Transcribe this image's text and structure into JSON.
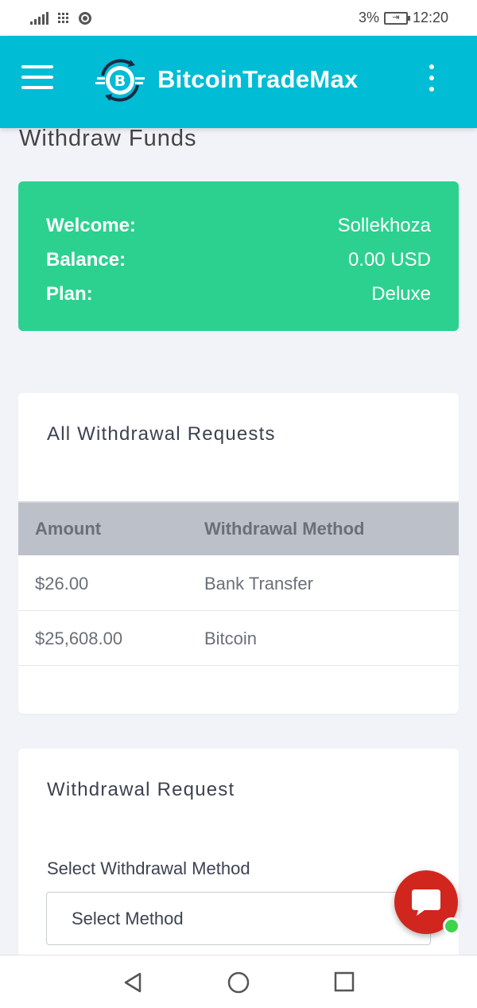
{
  "status_bar": {
    "battery_percent": "3%",
    "time": "12:20",
    "icons": [
      "signal-icon",
      "app-grid-icon",
      "chrome-icon",
      "battery-charging-icon"
    ]
  },
  "app_bar": {
    "brand": "BitcoinTradeMax",
    "icons": [
      "menu-icon",
      "bitcoin-logo-icon",
      "more-vert-icon"
    ],
    "accent_color": "#00bcd4"
  },
  "page": {
    "title": "Withdraw Funds"
  },
  "summary_card": {
    "color": "#2cd18f",
    "rows": [
      {
        "label": "Welcome:",
        "value": "Sollekhoza"
      },
      {
        "label": "Balance:",
        "value": "0.00 USD"
      },
      {
        "label": "Plan:",
        "value": "Deluxe"
      }
    ]
  },
  "requests_card": {
    "title": "All Withdrawal Requests",
    "columns": [
      "Amount",
      "Withdrawal Method"
    ],
    "rows": [
      {
        "amount": "$26.00",
        "method": "Bank Transfer"
      },
      {
        "amount": "$25,608.00",
        "method": "Bitcoin"
      }
    ]
  },
  "request_form": {
    "title": "Withdrawal Request",
    "method_label": "Select Withdrawal Method",
    "method_select_value": "Select Method"
  },
  "chat_widget": {
    "icon": "chat-bubble-icon",
    "status": "online",
    "color": "#d1261e"
  },
  "nav_bar": {
    "icons": [
      "back-icon",
      "home-icon",
      "recents-icon"
    ]
  }
}
